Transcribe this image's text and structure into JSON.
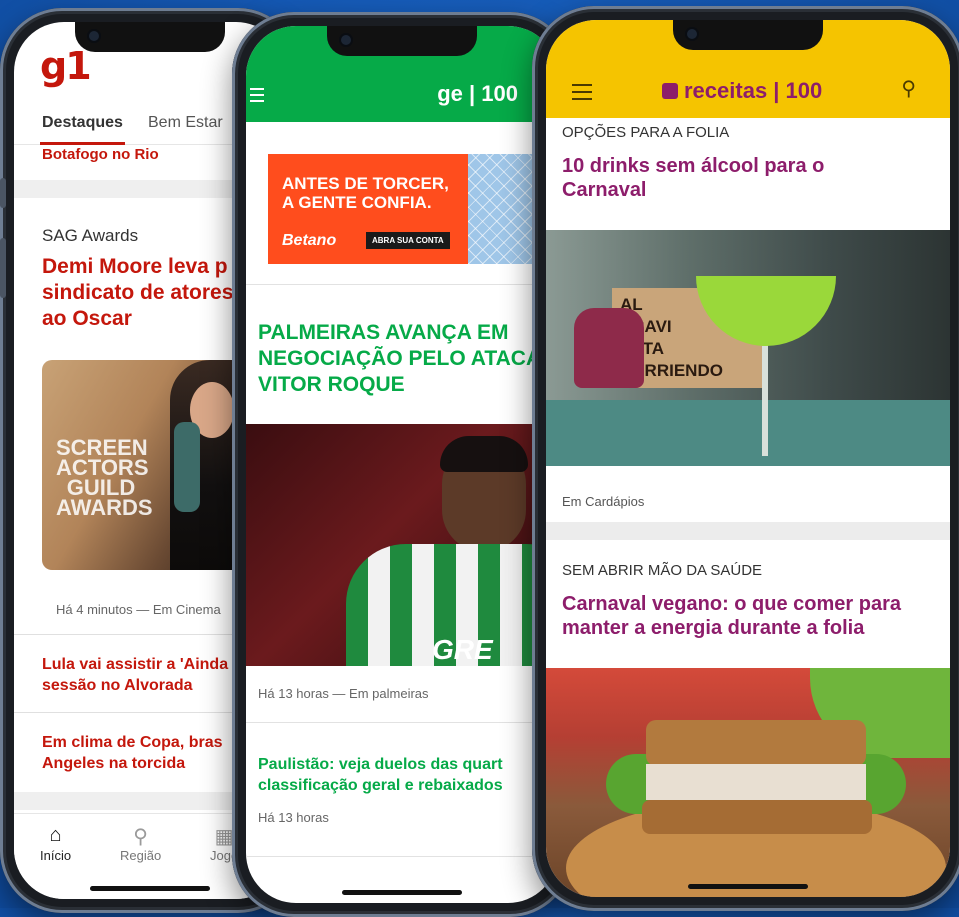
{
  "g1": {
    "logo": "g1",
    "tabs": [
      "Destaques",
      "Bem Estar"
    ],
    "top_fragment": "Botafogo no Rio",
    "section": "SAG Awards",
    "headline_lines": [
      "Demi Moore leva p",
      "sindicato de atores",
      "ao Oscar"
    ],
    "image_text": "SCREEN ACTORS GUILD AWARDS",
    "meta": "Há 4 minutos — Em Cinema",
    "story2_lines": [
      "Lula vai assistir a 'Ainda",
      "sessão no Alvorada"
    ],
    "story3_lines": [
      "Em clima de Copa, bras",
      "Angeles na torcida"
    ],
    "nav": [
      "Início",
      "Região",
      "Jogo"
    ]
  },
  "ge": {
    "logo": "ge | 100",
    "ad_text_lines": [
      "ANTES DE TORCER,",
      "A GENTE CONFIA."
    ],
    "ad_brand": "Betano",
    "ad_button": "ABRA SUA CONTA",
    "headline_lines": [
      "PALMEIRAS AVANÇA EM",
      "NEGOCIAÇÃO PELO ATACA",
      "VITOR ROQUE"
    ],
    "photo_sponsor": "GRE",
    "meta1": "Há 13 horas — Em palmeiras",
    "sub_lines": [
      "Paulistão: veja duelos das quart",
      "classificação geral e rebaixados"
    ],
    "meta2": "Há 13 horas"
  },
  "receitas": {
    "logo": "receitas | 100",
    "kicker1": "OPÇÕES PARA A FOLIA",
    "title1_lines": [
      "10 drinks sem álcool para o",
      "Carnaval"
    ],
    "img1_sign": "AL\nARAVI\nESTA\nCURRIENDO",
    "meta1": "Em Cardápios",
    "kicker2": "SEM ABRIR MÃO DA SAÚDE",
    "title2_lines": [
      "Carnaval vegano: o que comer para",
      "manter a energia durante a folia"
    ]
  },
  "colors": {
    "background": "#1559b5",
    "g1_red": "#c4170c",
    "ge_green": "#06aa48",
    "receitas_yellow": "#f5c400",
    "receitas_purple": "#8d1d6b",
    "betano_orange": "#ff4d1d"
  },
  "icons": {
    "g1_nav": [
      "home-icon",
      "map-pin-icon",
      "games-icon"
    ],
    "ge_header": "hamburger-menu-icon",
    "receitas_header": [
      "hamburger-menu-icon",
      "search-icon"
    ]
  }
}
